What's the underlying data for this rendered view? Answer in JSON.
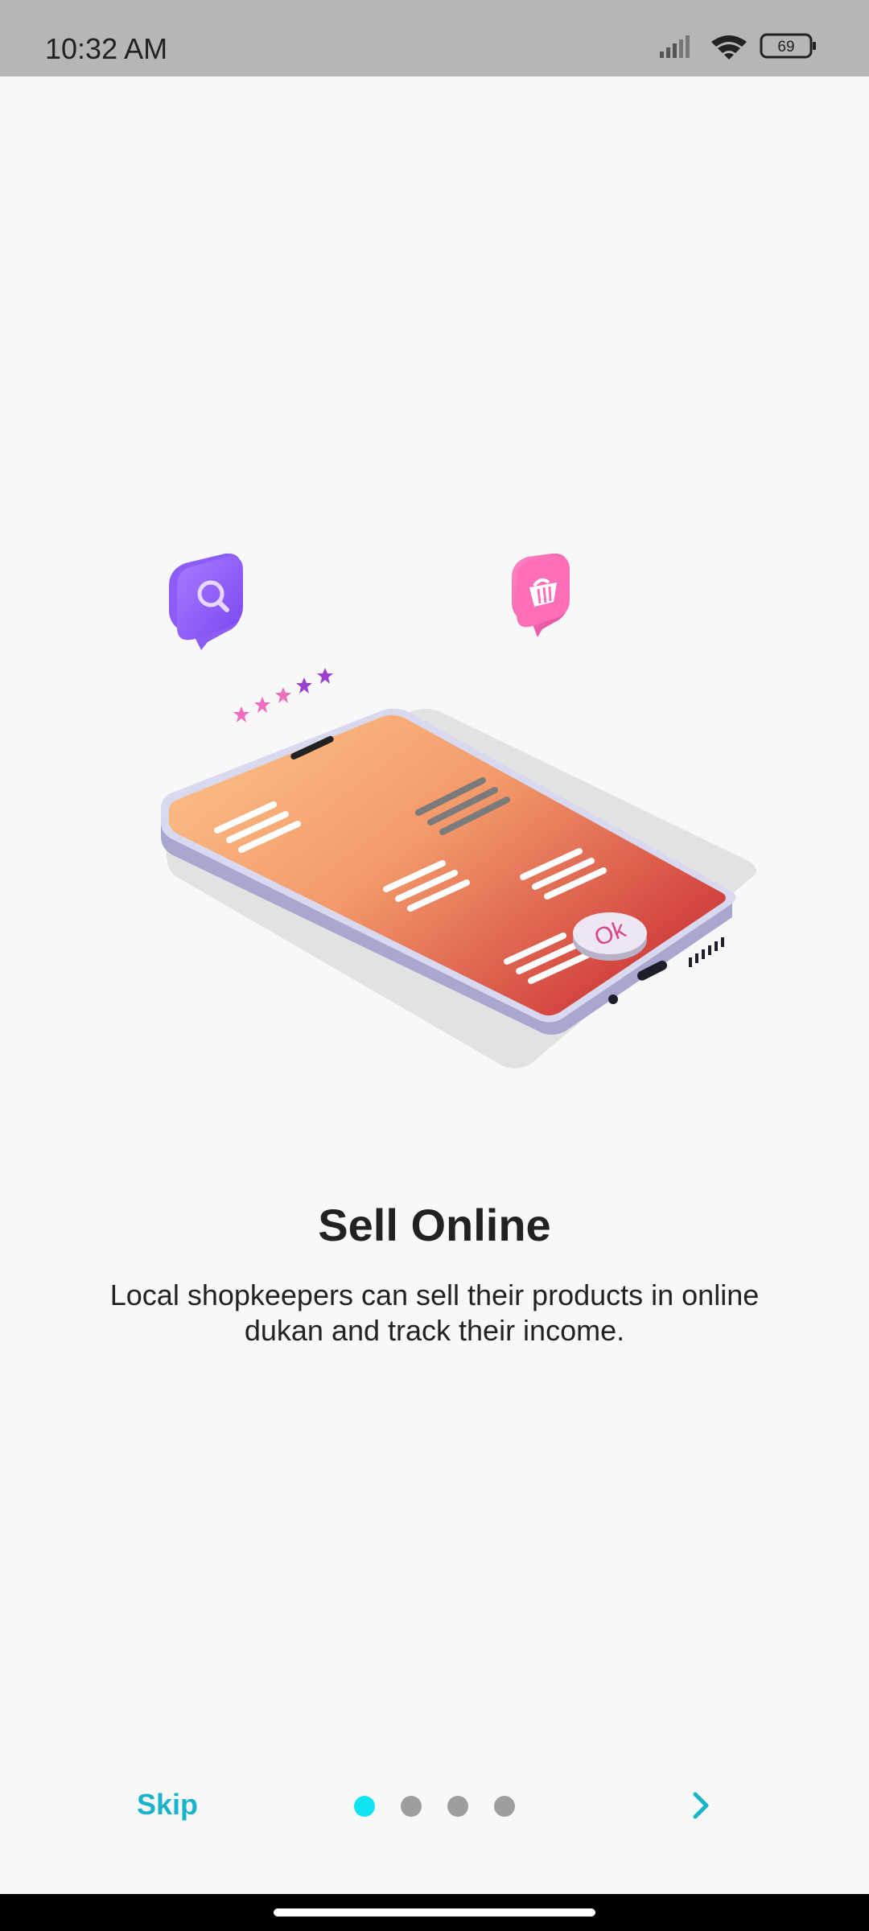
{
  "status_bar": {
    "time": "10:32 AM",
    "battery": "69",
    "icons": [
      "signal-icon",
      "wifi-icon",
      "battery-icon"
    ]
  },
  "onboarding": {
    "title": "Sell Online",
    "description": "Local shopkeepers can sell their products in online dukan and track their income.",
    "illustration_badge": "Ok",
    "current_page": 1,
    "total_pages": 4
  },
  "footer": {
    "skip_label": "Skip",
    "next_icon": "chevron-right-icon"
  },
  "colors": {
    "accent": "#1ab3cc",
    "active_dot": "#10e4f2",
    "inactive_dot": "#9e9e9e",
    "background": "#f8f8f8"
  }
}
